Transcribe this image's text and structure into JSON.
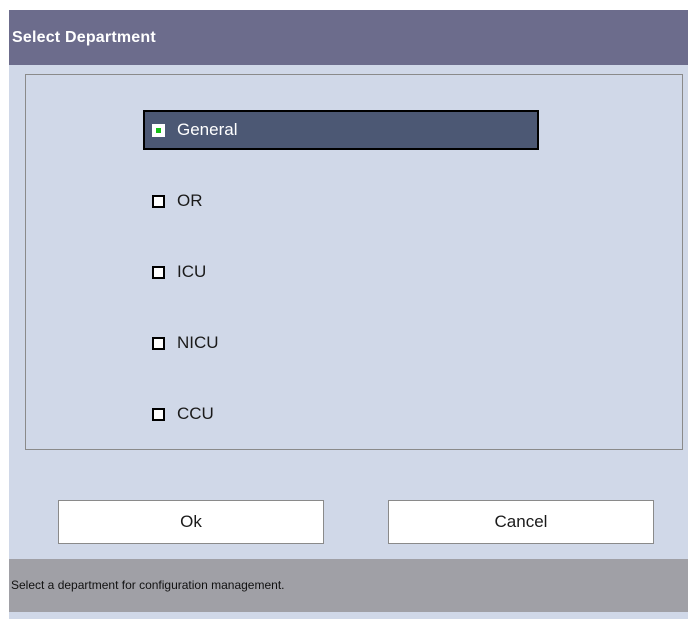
{
  "dialog": {
    "title": "Select Department"
  },
  "options": [
    {
      "label": "General",
      "selected": true
    },
    {
      "label": "OR",
      "selected": false
    },
    {
      "label": "ICU",
      "selected": false
    },
    {
      "label": "NICU",
      "selected": false
    },
    {
      "label": "CCU",
      "selected": false
    }
  ],
  "buttons": {
    "ok_label": "Ok",
    "cancel_label": "Cancel"
  },
  "status": {
    "message": "Select a department for configuration management."
  },
  "colors": {
    "title_bar": "#6c6c8c",
    "panel_bg": "#d0d8e8",
    "selected_bg": "#4c5874",
    "check_green": "#18c018",
    "status_bar": "#a0a0a6"
  }
}
